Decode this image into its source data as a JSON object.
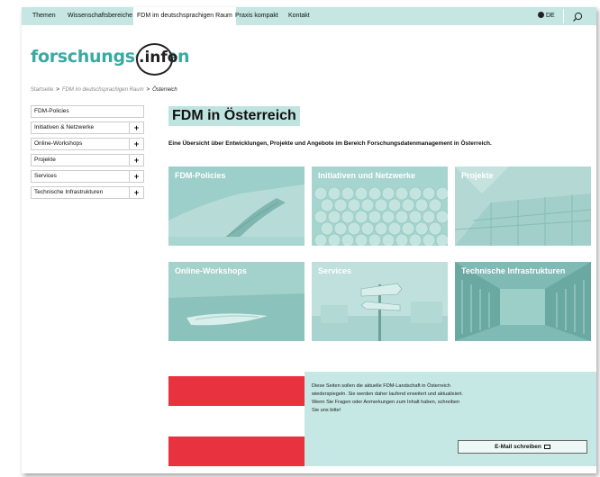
{
  "nav": {
    "items": [
      "Themen",
      "Wissenschaftsbereiche",
      "FDM im deutschsprachigen Raum",
      "Praxis kompakt",
      "Kontakt"
    ],
    "language": "DE"
  },
  "logo": {
    "text": "forschungsdaten",
    "suffix": ".info"
  },
  "breadcrumb": {
    "items": [
      "Startseite",
      "FDM im deutschsprachigen Raum"
    ],
    "current": "Österreich",
    "separator": ">"
  },
  "sidebar": {
    "items": [
      {
        "label": "FDM-Policies",
        "expandable": false
      },
      {
        "label": "Initiativen & Netzwerke",
        "expandable": true
      },
      {
        "label": "Online-Workshops",
        "expandable": true
      },
      {
        "label": "Projekte",
        "expandable": true
      },
      {
        "label": "Services",
        "expandable": true
      },
      {
        "label": "Technische Infrastrukturen",
        "expandable": true
      }
    ],
    "expand_symbol": "+"
  },
  "main": {
    "title": "FDM in Österreich",
    "subtitle": "Eine Übersicht über Entwicklungen, Projekte und Angebote im Bereich Forschungsdatenmanagement in Österreich.",
    "tiles": [
      "FDM-Policies",
      "Initiativen und Netzwerke",
      "Projekte",
      "Online-Workshops",
      "Services",
      "Technische Infrastrukturen"
    ]
  },
  "info": {
    "text": "Diese Seiten sollen die aktuelle FDM-Landschaft in Österreich wiederspiegeln. Sie werden daher laufend erweitert und aktualisiert. Wenn Sie Fragen oder Anmerkungen zum Inhalt haben, schreiben Sie uns bitte!",
    "button": "E-Mail schreiben"
  },
  "colors": {
    "nav_bg": "#c5e6e3",
    "accent": "#3aa9a2",
    "tile_overlay": "#8fcbc5",
    "flag_red": "#e8323f",
    "info_bg": "#c6e8e4"
  },
  "icons": {
    "language": "globe-icon",
    "search": "search-icon",
    "mail": "envelope-icon"
  }
}
